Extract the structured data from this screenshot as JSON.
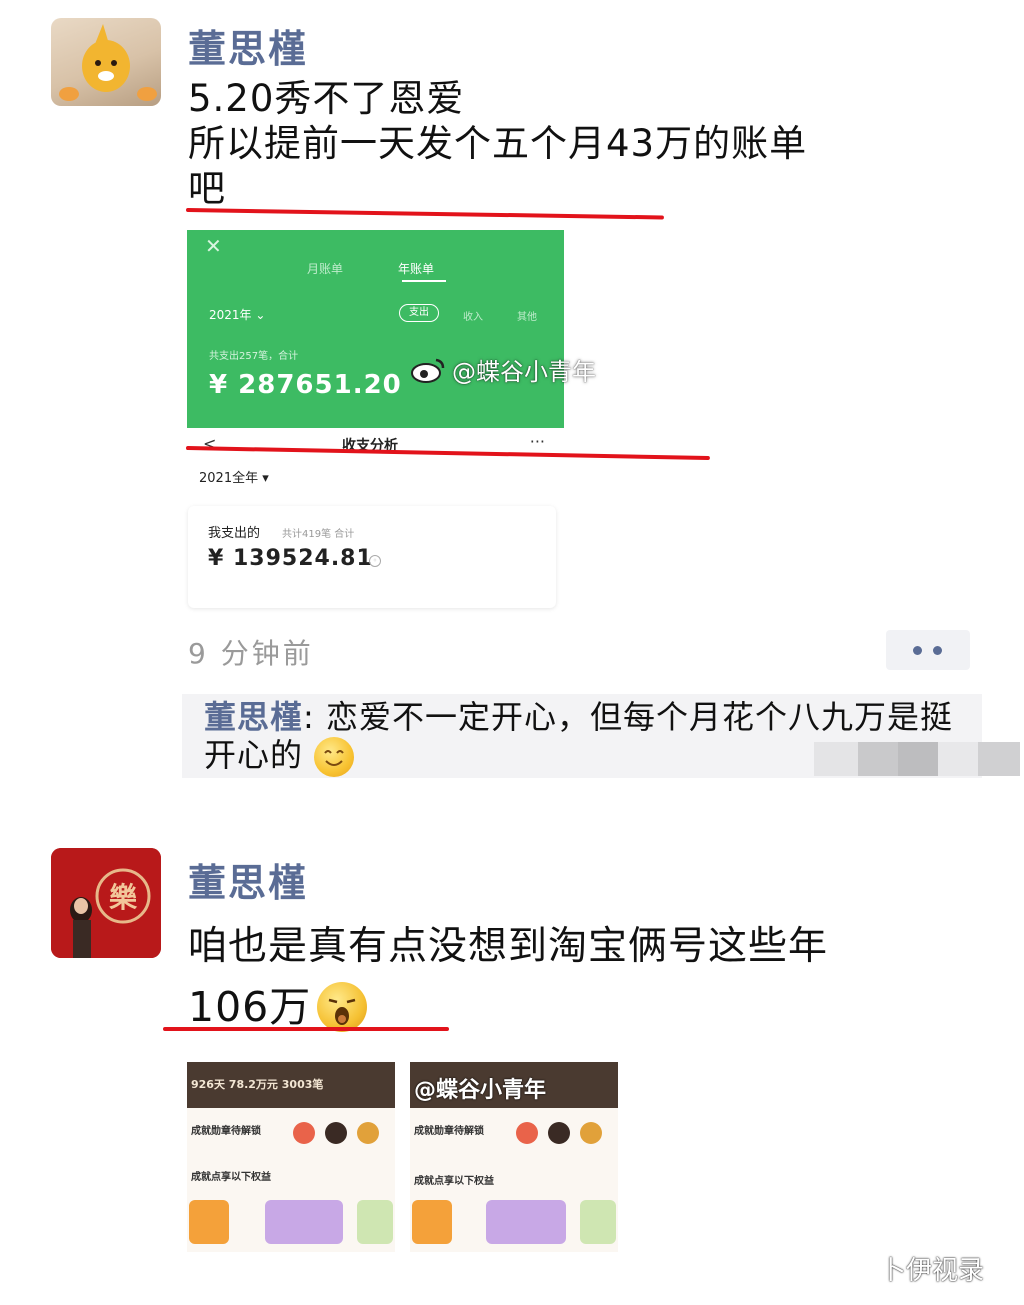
{
  "post1": {
    "username": "董思槿",
    "lines": [
      "5.20秀不了恩爱",
      "所以提前一天发个五个月43万的账单",
      "吧"
    ],
    "bill_screenshot": {
      "close_glyph": "✕",
      "tab_monthly": "月账单",
      "tab_yearly": "年账单",
      "year": "2021年 ⌄",
      "filter_expense": "支出",
      "filter_income": "收入",
      "filter_other": "其他",
      "summary": "共支出257笔，合计",
      "amount": "¥ 287651.20"
    },
    "watermark": "@蝶谷小青年",
    "analysis_screenshot": {
      "back": "<",
      "title": "收支分析",
      "more": "···",
      "year": "2021全年 ▾",
      "label": "我支出的",
      "count": "共计419笔 合计",
      "amount": "¥ 139524.81"
    },
    "timestamp": "9 分钟前",
    "comment": {
      "user": "董思槿",
      "text": ": 恋爱不一定开心，但每个月花个八九万是挺开心的"
    }
  },
  "post2": {
    "username": "董思槿",
    "avatar_char": "樂",
    "lines": [
      "咱也是真有点没想到淘宝俩号这些年",
      "106万"
    ],
    "taobao_left": {
      "header": "926天 78.2万元 3003笔",
      "row1": "成就勋章待解锁",
      "row2": "成就点享以下权益"
    },
    "taobao_right": {
      "header": "@蝶谷小青年",
      "row1": "成就勋章待解锁",
      "row2": "成就点享以下权益"
    }
  },
  "corner_watermark": "卜伊视录",
  "colors": {
    "username": "#5a6c95",
    "underline": "#e2131b",
    "wechat_green": "#3dbb63"
  }
}
